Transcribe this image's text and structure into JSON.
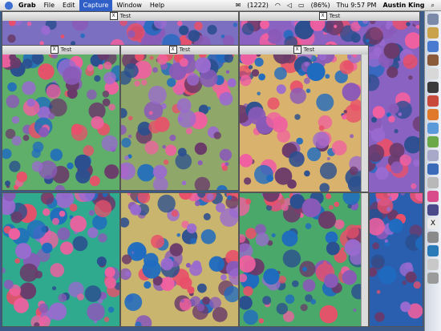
{
  "menubar": {
    "app_name": "Grab",
    "menus": [
      "File",
      "Edit",
      "Capture",
      "Window",
      "Help"
    ],
    "active_menu": "Capture",
    "mail_count": "(1222)",
    "battery": "(86%)",
    "clock": "Thu 9:57 PM",
    "user": "Austin King"
  },
  "window_title": "Test",
  "windows": [
    {
      "id": "w-top-left-back",
      "bg": "#7a6fc0",
      "seed": 11
    },
    {
      "id": "w-top-right-back",
      "bg": "#8a62c2",
      "seed": 12
    },
    {
      "id": "w-row1-a",
      "bg": "#5fae6a",
      "seed": 1
    },
    {
      "id": "w-row1-b",
      "bg": "#8fa86a",
      "seed": 2
    },
    {
      "id": "w-row1-c",
      "bg": "#d9b36e",
      "seed": 3
    },
    {
      "id": "w-row2-a",
      "bg": "#2faa8e",
      "seed": 4
    },
    {
      "id": "w-row2-b",
      "bg": "#c9b56e",
      "seed": 5
    },
    {
      "id": "w-row2-c",
      "bg": "#4aa86a",
      "seed": 6
    },
    {
      "id": "w-row2-d",
      "bg": "#2a5fb0",
      "seed": 7
    }
  ],
  "bubble_colors": [
    "#e8506a",
    "#2b4f8f",
    "#8a5ab8",
    "#6a3a6a",
    "#f060a0",
    "#1f6bc0",
    "#9a6ad0"
  ]
}
